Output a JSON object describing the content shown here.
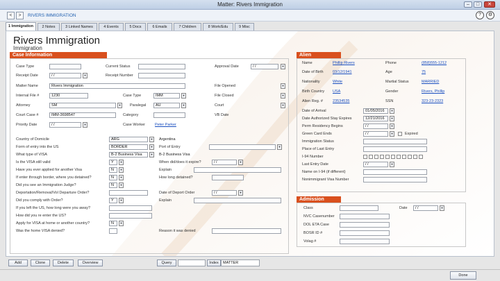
{
  "window": {
    "title": "Matter: Rivers Immigration",
    "minimize": "–",
    "maximize": "□",
    "close": "✕"
  },
  "nav": {
    "back": "<",
    "forward": ">",
    "breadcrumb": "RIVERS IMMIGRATION",
    "help": "?",
    "prefs": "⚙"
  },
  "tabs": [
    "1 Immigration",
    "2 Notes",
    "3 Linked Names",
    "4 Events",
    "5 Docs",
    "6 Emails",
    "7 Children",
    "8 Work/Edu",
    "9 Misc"
  ],
  "header": {
    "title": "Rivers Immigration",
    "subtitle": "Immigration"
  },
  "case": {
    "section_title": "Case Information",
    "case_type_label": "Case Type",
    "current_status_label": "Current Status",
    "approval_date_label": "Approval Date",
    "approval_date": "/ /",
    "receipt_date_label": "Receipt Date",
    "receipt_date": "/ /",
    "receipt_number_label": "Receipt Number",
    "matter_name_label": "Matter Name",
    "matter_name": "Rivers Immigration",
    "file_opened_label": "File Opened",
    "internal_file_label": "Internal File #",
    "internal_file": "1230",
    "case_type2_label": "Case Type",
    "case_type2": "IMM",
    "file_closed_label": "File Closed",
    "attorney_label": "Attorney",
    "attorney": "SM",
    "paralegal_label": "Paralegal",
    "paralegal": "AU",
    "court_label": "Court",
    "court_case_label": "Court Case #",
    "court_case": "IMM-3698547",
    "category_label": "Category",
    "vb_date_label": "VB Date",
    "priority_date_label": "Priority Date",
    "priority_date": "/ /",
    "case_worker_label": "Case Worker",
    "case_worker": "Peter Parker"
  },
  "visa": {
    "country_domicile_label": "Country of Domicile",
    "country_domicile": "ARG",
    "country_domicile_name": "Argentina",
    "form_entry_label": "Form of entry into the US",
    "form_entry": "BORDER",
    "port_entry_label": "Port of Entry",
    "visa_type_label": "What type of VISA",
    "visa_type": "B-2 Business Visa",
    "visa_type_name": "B-2 Business Visa",
    "still_valid_label": "Is the VISA still valid",
    "still_valid": "Y",
    "expire_label": "When did/does it expire?",
    "expire": "/ /",
    "applied_other_label": "Have you ever applied for another Visa",
    "applied_other": "N",
    "explain1_label": "Explain",
    "detained_label": "If enter through border, where you detained?",
    "detained": "N",
    "how_long_detained_label": "How long detained?",
    "judge_label": "Did you see an Immigration Judge?",
    "judge": "N",
    "deportation_label": "Deportation/Removal/Vol Departure Order?",
    "deport_date_label": "Date of Deport Order",
    "deport_date": "/ /",
    "comply_label": "Did you comply with Order?",
    "comply": "Y",
    "explain2_label": "Explain",
    "left_us_label": "If you left the US, how long were you away?",
    "reenter_label": "How did you re enter the US?",
    "apply_home_label": "Apply for VISA at home or another country?",
    "apply_home": "N",
    "home_denied_label": "Was the home VISA denied?",
    "reason_denied_label": "Reason it was denied"
  },
  "alien": {
    "section_title": "Alien",
    "name_label": "Name",
    "name": "Phillip Rivers",
    "phone_label": "Phone",
    "phone": "(858)555-1212",
    "dob_label": "Date of Birth",
    "dob": "03/12/1941",
    "age_label": "Age",
    "age": "75",
    "nationality_label": "Nationality",
    "nationality": "White",
    "marital_label": "Martial Status",
    "marital": "MARRIED",
    "birth_country_label": "Birth Country",
    "birth_country": "USA",
    "gender_label": "Gender",
    "gender": "Rivers, Phillip",
    "alien_reg_label": "Alien Reg. #",
    "alien_reg": "23534535",
    "ssn_label": "SSN",
    "ssn": "323-23-2323",
    "arrival_label": "Date of Arrival",
    "arrival": "01/05/2016",
    "stay_expires_label": "Date Authorized Stay Expires",
    "stay_expires": "12/21/2016",
    "perm_res_label": "Perm Residency Begins",
    "perm_res": "/ /",
    "green_card_label": "Green Card Ends",
    "green_card": "/ /",
    "expired_label": "Expired",
    "imm_status_label": "Immigration Status",
    "last_entry_place_label": "Place of Last Entry",
    "i94_label": "I-94 Number",
    "last_entry_date_label": "Last Entry Date",
    "last_entry_date": "/ /",
    "name_i94_label": "Name on I-94 (if different)",
    "nonimm_visa_label": "Nonimmigrant Visa Number"
  },
  "admission": {
    "section_title": "Admission",
    "class_label": "Class",
    "date_label": "Date",
    "date": "/ /",
    "nvc_label": "NVC Casenumber",
    "dol_label": "DOL ETA Case",
    "bosr_label": "BOSR ID #",
    "volag_label": "Volag #"
  },
  "bottom": {
    "add": "Add",
    "clone": "Clone",
    "delete": "Delete",
    "overview": "Overview",
    "query": "Query",
    "index_label": "Index",
    "index_value": "MATTER",
    "done": "Done"
  }
}
